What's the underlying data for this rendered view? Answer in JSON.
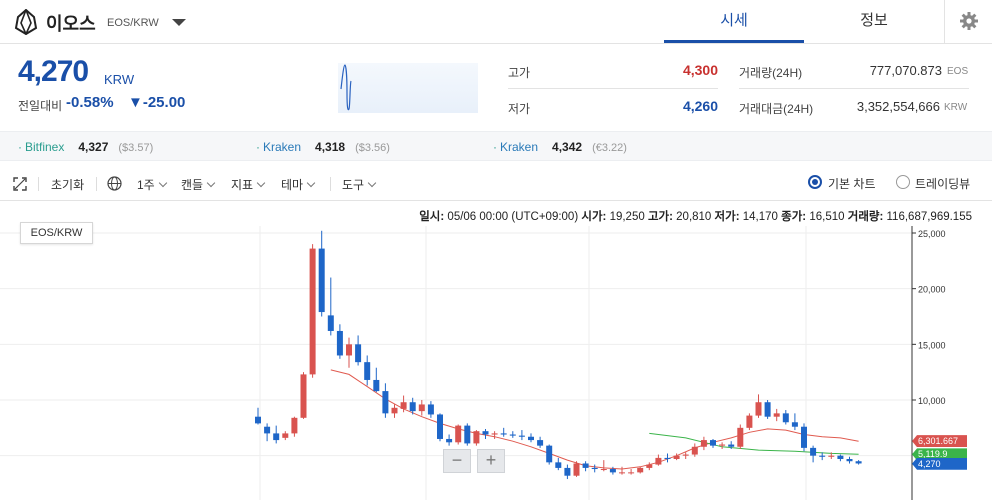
{
  "header": {
    "coin_name": "이오스",
    "pair": "EOS/KRW",
    "tabs": [
      {
        "label": "시세",
        "active": true
      },
      {
        "label": "정보",
        "active": false
      }
    ]
  },
  "price": {
    "current": "4,270",
    "currency": "KRW",
    "change_label": "전일대비",
    "change_pct": "-0.58%",
    "change_val": "▼-25.00"
  },
  "stats": {
    "high_label": "고가",
    "high": "4,300",
    "low_label": "저가",
    "low": "4,260",
    "volume_label": "거래량(24H)",
    "volume": "777,070.873",
    "volume_unit": "EOS",
    "amount_label": "거래대금(24H)",
    "amount": "3,352,554,666",
    "amount_unit": "KRW"
  },
  "exchanges": [
    {
      "name": "Bitfinex",
      "price": "4,327",
      "sub": "($3.57)"
    },
    {
      "name": "Kraken",
      "price": "4,318",
      "sub": "($3.56)"
    },
    {
      "name": "Kraken",
      "price": "4,342",
      "sub": "(€3.22)"
    }
  ],
  "toolbar": {
    "reset": "초기화",
    "period": "1주",
    "candle": "캔들",
    "indicator": "지표",
    "theme": "테마",
    "tools": "도구",
    "basic_chart": "기본 차트",
    "trading_view": "트레이딩뷰"
  },
  "ohlc_bar": {
    "date_label": "일시:",
    "date": "05/06 00:00 (UTC+09:00)",
    "open_label": "시가:",
    "open": "19,250",
    "high_label": "고가:",
    "high": "20,810",
    "low_label": "저가:",
    "low": "14,170",
    "close_label": "종가:",
    "close": "16,510",
    "vol_label": "거래량:",
    "vol": "116,687,969.155"
  },
  "chart_chip": "EOS/KRW",
  "zoom": {
    "minus": "−",
    "plus": "+"
  },
  "colors": {
    "up": "#d9534f",
    "down": "#1e66c8",
    "accent": "#1a4fa8",
    "ma_red": "#e05a4f",
    "ma_green": "#3bb44a"
  },
  "chart_data": {
    "type": "candlestick",
    "y_ticks": [
      "25,000",
      "20,000",
      "15,000",
      "10,000"
    ],
    "y_range": [
      3000,
      26000
    ],
    "tags": [
      {
        "label": "6,301.667",
        "value": 6301.667,
        "color": "#d9534f"
      },
      {
        "label": "5,119.9",
        "value": 5119.9,
        "color": "#3bb44a"
      },
      {
        "label": "4,270",
        "value": 4270,
        "color": "#1e66c8"
      }
    ],
    "candles": [
      [
        8500,
        9300,
        7800,
        7900
      ],
      [
        7600,
        7900,
        6300,
        7000
      ],
      [
        7000,
        7700,
        6100,
        6400
      ],
      [
        6600,
        7200,
        6400,
        7000
      ],
      [
        7000,
        8500,
        6700,
        8400
      ],
      [
        8400,
        12500,
        8300,
        12300
      ],
      [
        12300,
        24000,
        12000,
        23600
      ],
      [
        23600,
        25200,
        17500,
        17900
      ],
      [
        17600,
        21000,
        15800,
        16200
      ],
      [
        16200,
        16800,
        13700,
        14000
      ],
      [
        14000,
        15600,
        12900,
        15000
      ],
      [
        15000,
        15800,
        13100,
        13400
      ],
      [
        13400,
        14000,
        11300,
        11800
      ],
      [
        11800,
        12900,
        10700,
        10800
      ],
      [
        10800,
        11500,
        8400,
        8800
      ],
      [
        8800,
        9600,
        8400,
        9300
      ],
      [
        9200,
        10400,
        8900,
        9800
      ],
      [
        9800,
        10200,
        8700,
        9000
      ],
      [
        9000,
        10000,
        8600,
        9600
      ],
      [
        9600,
        9900,
        8400,
        8700
      ],
      [
        8700,
        8800,
        6300,
        6500
      ],
      [
        6500,
        6900,
        5900,
        6200
      ],
      [
        6200,
        7800,
        6000,
        7700
      ],
      [
        7700,
        7900,
        5900,
        6100
      ],
      [
        6100,
        7300,
        5900,
        7200
      ],
      [
        7200,
        7400,
        6500,
        6900
      ],
      [
        6900,
        7200,
        6500,
        7000
      ],
      [
        7000,
        7500,
        6700,
        6900
      ],
      [
        6900,
        7200,
        6600,
        6800
      ],
      [
        6800,
        7300,
        6400,
        6700
      ],
      [
        6700,
        7000,
        6200,
        6400
      ],
      [
        6400,
        6700,
        5700,
        5900
      ],
      [
        5900,
        6000,
        4200,
        4400
      ],
      [
        4400,
        4800,
        3700,
        3900
      ],
      [
        3900,
        4200,
        2900,
        3200
      ],
      [
        3200,
        4500,
        3100,
        4300
      ],
      [
        4300,
        4500,
        3600,
        3900
      ],
      [
        3900,
        4200,
        3500,
        3800
      ],
      [
        3800,
        4600,
        3600,
        3800
      ],
      [
        3800,
        4000,
        3300,
        3500
      ],
      [
        3500,
        4000,
        3300,
        3500
      ],
      [
        3500,
        3800,
        3300,
        3500
      ],
      [
        3500,
        4000,
        3400,
        3900
      ],
      [
        3900,
        4400,
        3700,
        4200
      ],
      [
        4200,
        5100,
        4100,
        4800
      ],
      [
        4800,
        5200,
        4400,
        4700
      ],
      [
        4700,
        5200,
        4600,
        5000
      ],
      [
        5000,
        5300,
        4700,
        5100
      ],
      [
        5100,
        6100,
        4900,
        5800
      ],
      [
        5800,
        6700,
        5500,
        6400
      ],
      [
        6400,
        6500,
        5700,
        5900
      ],
      [
        5900,
        6200,
        5600,
        6000
      ],
      [
        6000,
        6300,
        5600,
        5800
      ],
      [
        5800,
        7800,
        5600,
        7500
      ],
      [
        7500,
        8800,
        7300,
        8600
      ],
      [
        8600,
        10500,
        8400,
        9800
      ],
      [
        9800,
        10000,
        8300,
        8500
      ],
      [
        8500,
        9200,
        8100,
        8800
      ],
      [
        8800,
        9100,
        7800,
        8000
      ],
      [
        8000,
        8800,
        7300,
        7600
      ],
      [
        7600,
        7900,
        5400,
        5700
      ],
      [
        5700,
        5900,
        4400,
        5000
      ],
      [
        5000,
        5300,
        4600,
        4900
      ],
      [
        4900,
        5300,
        4700,
        5000
      ],
      [
        5000,
        5100,
        4500,
        4700
      ],
      [
        4700,
        4900,
        4300,
        4500
      ],
      [
        4500,
        4600,
        4200,
        4300
      ]
    ],
    "ma_red": [
      [
        8,
        12700
      ],
      [
        10,
        12300
      ],
      [
        12,
        11200
      ],
      [
        14,
        10100
      ],
      [
        16,
        9200
      ],
      [
        18,
        8500
      ],
      [
        20,
        7900
      ],
      [
        22,
        7400
      ],
      [
        24,
        7000
      ],
      [
        26,
        6700
      ],
      [
        28,
        6300
      ],
      [
        30,
        5800
      ],
      [
        32,
        5200
      ],
      [
        34,
        4600
      ],
      [
        36,
        4100
      ],
      [
        38,
        3900
      ],
      [
        40,
        3800
      ],
      [
        42,
        4000
      ],
      [
        44,
        4400
      ],
      [
        46,
        5000
      ],
      [
        48,
        5700
      ],
      [
        50,
        6200
      ],
      [
        52,
        6600
      ],
      [
        54,
        7100
      ],
      [
        56,
        7400
      ],
      [
        58,
        7300
      ],
      [
        60,
        6900
      ],
      [
        62,
        6700
      ],
      [
        64,
        6600
      ],
      [
        66,
        6300
      ]
    ],
    "ma_green": [
      [
        43,
        7000
      ],
      [
        47,
        6600
      ],
      [
        51,
        5800
      ],
      [
        55,
        5500
      ],
      [
        59,
        5400
      ],
      [
        63,
        5200
      ],
      [
        66,
        5120
      ]
    ]
  }
}
